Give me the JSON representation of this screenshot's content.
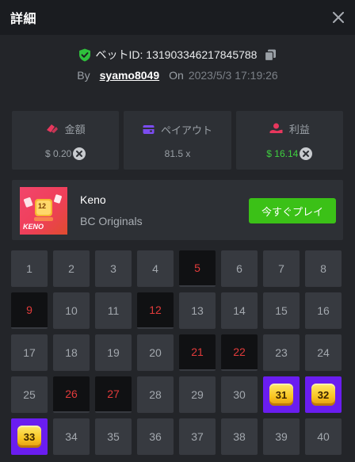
{
  "header": {
    "title": "詳細"
  },
  "bet": {
    "id_label": "ベットID: 131903346217845788",
    "by_label": "By",
    "username": "syamo8049",
    "on_label": "On",
    "date": "2023/5/3 17:19:26"
  },
  "stats": [
    {
      "label": "金額",
      "value": "$ 0.20",
      "icon": "money-icon",
      "color": "#e8375d"
    },
    {
      "label": "ペイアウト",
      "value": "81.5 x",
      "icon": "wallet-icon",
      "color": "#7b4cf0"
    },
    {
      "label": "利益",
      "value": "$ 16.14",
      "icon": "profit-icon",
      "color": "#e8375d"
    }
  ],
  "game": {
    "name": "Keno",
    "provider": "BC Originals",
    "thumb_badge": "12",
    "thumb_logo": "KENO",
    "play_label": "今すぐプレイ"
  },
  "grid": [
    {
      "n": "1",
      "s": "none"
    },
    {
      "n": "2",
      "s": "none"
    },
    {
      "n": "3",
      "s": "none"
    },
    {
      "n": "4",
      "s": "none"
    },
    {
      "n": "5",
      "s": "miss"
    },
    {
      "n": "6",
      "s": "none"
    },
    {
      "n": "7",
      "s": "none"
    },
    {
      "n": "8",
      "s": "none"
    },
    {
      "n": "9",
      "s": "miss"
    },
    {
      "n": "10",
      "s": "none"
    },
    {
      "n": "11",
      "s": "none"
    },
    {
      "n": "12",
      "s": "miss"
    },
    {
      "n": "13",
      "s": "none"
    },
    {
      "n": "14",
      "s": "none"
    },
    {
      "n": "15",
      "s": "none"
    },
    {
      "n": "16",
      "s": "none"
    },
    {
      "n": "17",
      "s": "none"
    },
    {
      "n": "18",
      "s": "none"
    },
    {
      "n": "19",
      "s": "none"
    },
    {
      "n": "20",
      "s": "none"
    },
    {
      "n": "21",
      "s": "miss"
    },
    {
      "n": "22",
      "s": "miss"
    },
    {
      "n": "23",
      "s": "none"
    },
    {
      "n": "24",
      "s": "none"
    },
    {
      "n": "25",
      "s": "none"
    },
    {
      "n": "26",
      "s": "miss"
    },
    {
      "n": "27",
      "s": "miss"
    },
    {
      "n": "28",
      "s": "none"
    },
    {
      "n": "29",
      "s": "none"
    },
    {
      "n": "30",
      "s": "none"
    },
    {
      "n": "31",
      "s": "hit"
    },
    {
      "n": "32",
      "s": "hit"
    },
    {
      "n": "33",
      "s": "hit"
    },
    {
      "n": "34",
      "s": "none"
    },
    {
      "n": "35",
      "s": "none"
    },
    {
      "n": "36",
      "s": "none"
    },
    {
      "n": "37",
      "s": "none"
    },
    {
      "n": "38",
      "s": "none"
    },
    {
      "n": "39",
      "s": "none"
    },
    {
      "n": "40",
      "s": "none"
    }
  ],
  "colors": {
    "accent_green": "#3bc117",
    "profit_green": "#3fcf3f",
    "hit_purple": "#6a1df0",
    "miss_red": "#e23b3b"
  }
}
